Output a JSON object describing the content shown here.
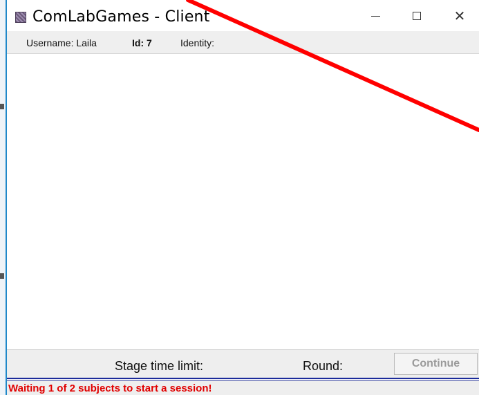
{
  "window": {
    "title": "ComLabGames - Client",
    "controls": {
      "minimize": "minimize",
      "maximize": "maximize",
      "close": "close"
    }
  },
  "infobar": {
    "username": "Username: Laila",
    "id": "Id: 7",
    "identity": "Identity:"
  },
  "bottombar": {
    "stage_time_limit": "Stage time limit:",
    "round": "Round:",
    "continue_label": "Continue"
  },
  "status": {
    "message": "Waiting 1 of 2 subjects to start a session!"
  },
  "colors": {
    "status_text": "#e10000",
    "annotation_line": "#ff0000",
    "window_border": "#1f88c9"
  }
}
